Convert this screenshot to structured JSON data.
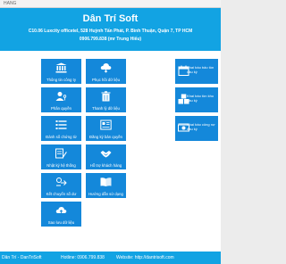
{
  "menubar": {
    "label": "HANG"
  },
  "header": {
    "title": "Dân Trí Soft",
    "address": "C10.06 Luxcity officetel, 528 Huỳnh Tấn Phát, P. Bình Thuận, Quận 7, TP HCM",
    "phone": "0906.799.838 (mr Trung Hiếu)"
  },
  "tiles": {
    "thong_tin": "Thông tin công ty",
    "phuc_hoi": "Phục hồi dữ liệu",
    "phan_quyen": "Phân quyền",
    "thanh_ly": "Thanh lý dữ liệu",
    "doi_so": "Đánh số chứng từ",
    "dang_ky": "Đăng ký bản quyền",
    "nhat_ky": "Nhật ký hệ thống",
    "ho_tro": "Hỗ trợ khách hàng",
    "ket_chuyen": "Kết chuyển số dư",
    "huong_dan": "Hướng dẫn sử dụng",
    "sao_luu": "Sao lưu dữ liệu",
    "kb_bao_ton": "Khai báo bảo tồn đầu kỳ",
    "kb_ban_dau": "Khai báo tồn kho đầu kỳ",
    "kb_cong_no": "Khai báo công nợ đầu kỳ"
  },
  "footer": {
    "brand": "Dân Trí - DanTriSoft",
    "hotline": "Hotline: 0906.799.838",
    "website": "Website: http://dantrisoft.com"
  },
  "colors": {
    "header": "#12a3e3",
    "tile": "#1488da",
    "background": "#ffffff"
  }
}
